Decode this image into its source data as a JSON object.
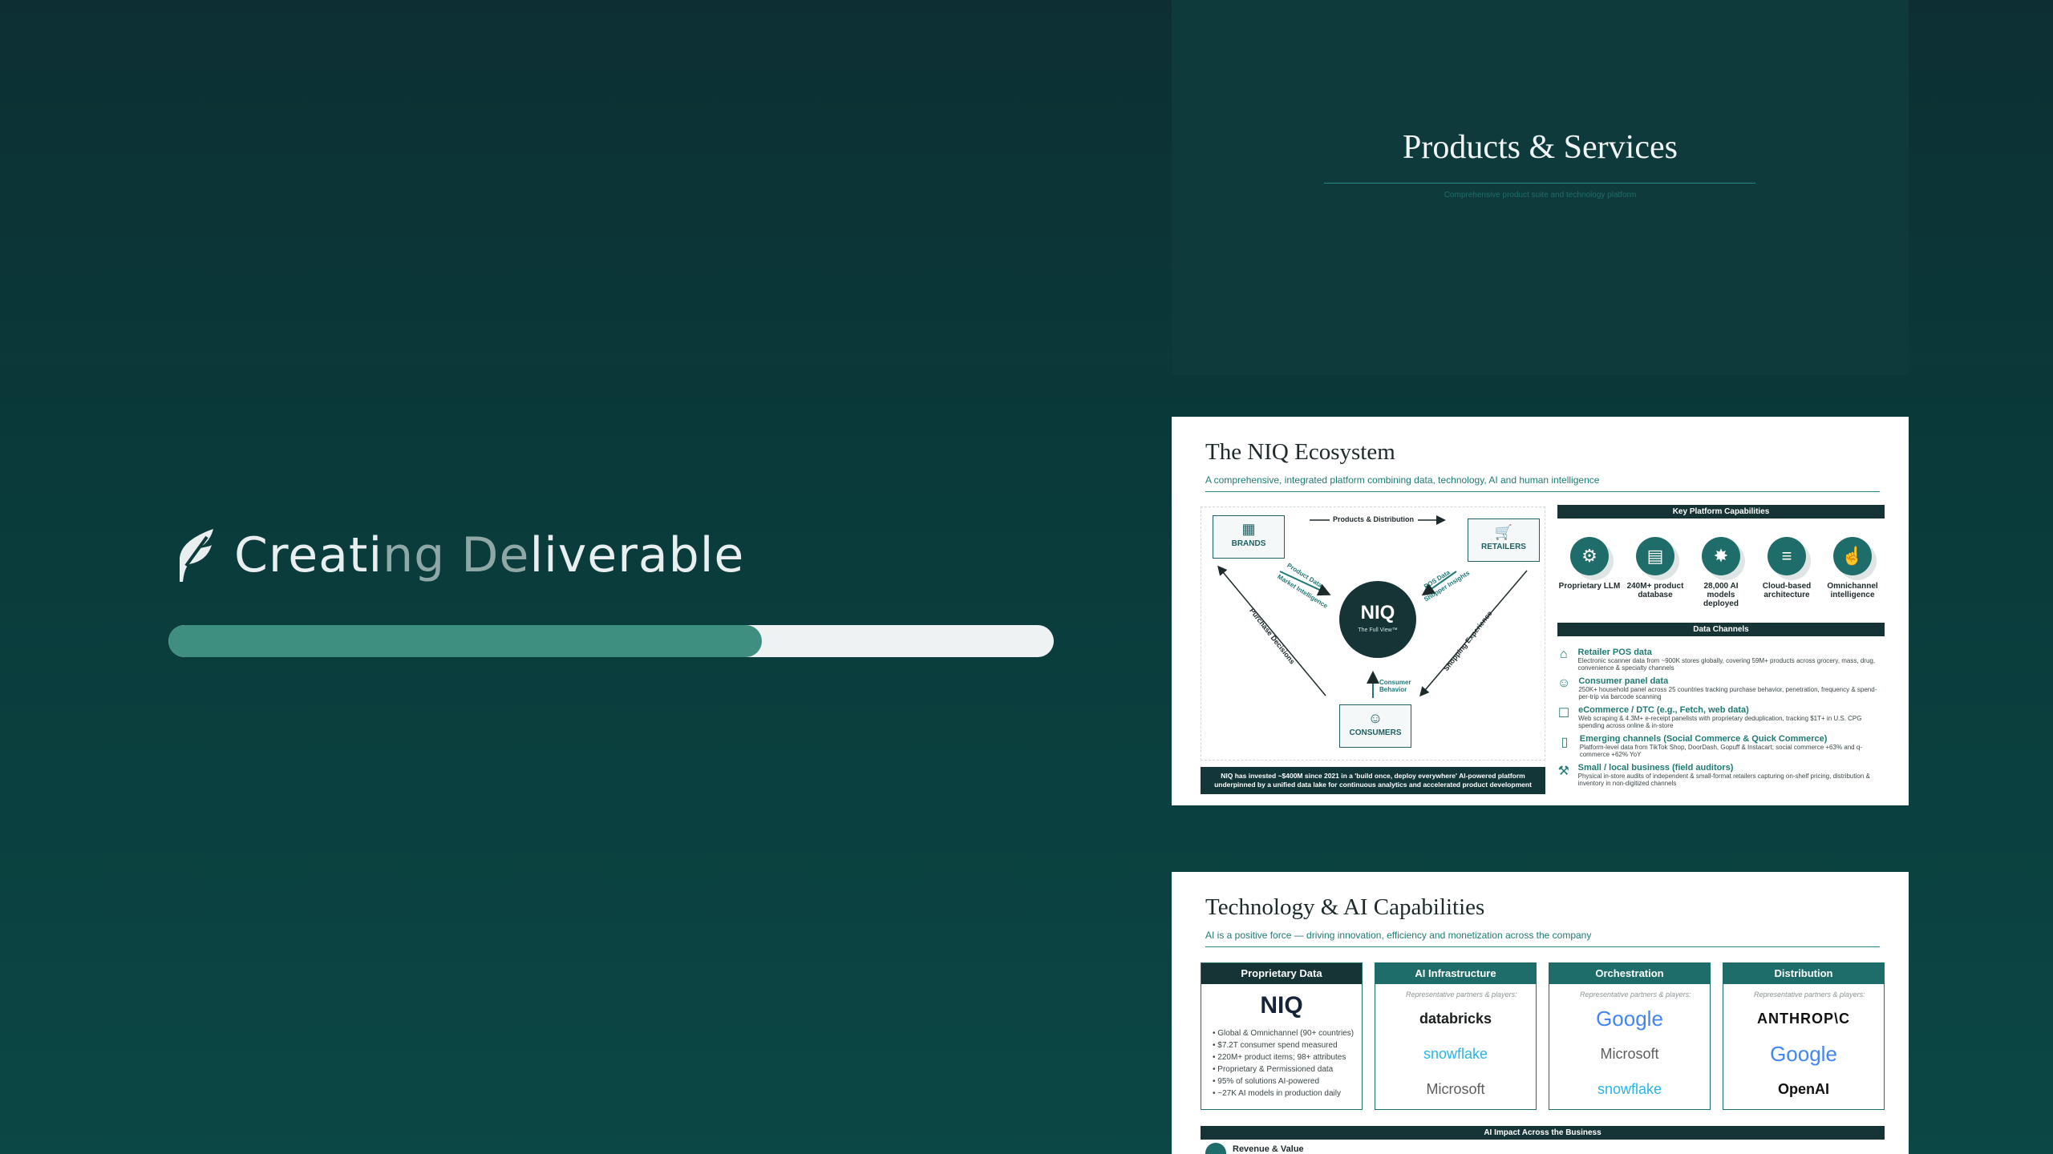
{
  "loader": {
    "title_part1": "Creati",
    "title_part2": "ng De",
    "title_part3": "liverable",
    "progress_fraction": 0.67,
    "colors": {
      "fill": "#3e8f7f",
      "track": "#eef2f2"
    }
  },
  "slide1": {
    "title": "Products & Services",
    "subtitle": "Comprehensive product suite and technology platform"
  },
  "slide2": {
    "title": "The NIQ Ecosystem",
    "subtitle": "A comprehensive, integrated platform combining data, technology, AI and human intelligence",
    "diagram": {
      "brands": "BRANDS",
      "retailers": "RETAILERS",
      "consumers": "CONSUMERS",
      "hub_title": "NIQ",
      "hub_sub": "The Full View™",
      "products_distribution": "Products & Distribution",
      "product_data": "Product Data",
      "market_intelligence": "Market Intelligence",
      "pos_data": "POS Data",
      "shopper_insights": "Shopper Insights",
      "purchase_decisions": "Purchase Decisions",
      "shopping_experience": "Shopping Experience",
      "consumer_behavior": "Consumer Behavior"
    },
    "investment_note": "NIQ has invested ~$400M since 2021 in a 'build once, deploy everywhere' AI-powered platform underpinned by a unified data lake for continuous analytics and accelerated product development",
    "capabilities_header": "Key Platform Capabilities",
    "capabilities": [
      {
        "icon": "llm-icon",
        "glyph": "⚙",
        "label": "Proprietary LLM"
      },
      {
        "icon": "database-icon",
        "glyph": "▤",
        "label": "240M+ product database"
      },
      {
        "icon": "ai-models-icon",
        "glyph": "✸",
        "label": "28,000 AI models deployed"
      },
      {
        "icon": "cloud-layers-icon",
        "glyph": "≡",
        "label": "Cloud-based architecture"
      },
      {
        "icon": "omnichannel-icon",
        "glyph": "☝",
        "label": "Omnichannel intelligence"
      }
    ],
    "channels_header": "Data Channels",
    "channels": [
      {
        "icon": "store-icon",
        "glyph": "⌂",
        "title": "Retailer POS data",
        "desc": "Electronic scanner data from ~900K stores globally, covering 59M+ products across grocery, mass, drug, convenience & specialty channels"
      },
      {
        "icon": "panel-icon",
        "glyph": "☺",
        "title": "Consumer panel data",
        "desc": "250K+ household panel across 25 countries tracking purchase behavior, penetration, frequency & spend-per-trip via barcode scanning"
      },
      {
        "icon": "ecommerce-icon",
        "glyph": "☐",
        "title": "eCommerce / DTC (e.g., Fetch, web data)",
        "desc": "Web scraping & 4.3M+ e-receipt panelists with proprietary deduplication, tracking $1T+ in U.S. CPG spending across online & in-store"
      },
      {
        "icon": "mobile-icon",
        "glyph": "▯",
        "title": "Emerging channels (Social Commerce & Quick Commerce)",
        "desc": "Platform-level data from TikTok Shop, DoorDash, Gopuff & Instacart; social commerce +63% and q-commerce +62% YoY"
      },
      {
        "icon": "field-auditor-icon",
        "glyph": "⚒",
        "title": "Small / local business (field auditors)",
        "desc": "Physical in-store audits of independent & small-format retailers capturing on-shelf pricing, distribution & inventory in non-digitized channels"
      }
    ]
  },
  "slide3": {
    "title": "Technology & AI Capabilities",
    "subtitle": "AI is a positive force — driving innovation, efficiency and monetization across the company",
    "rep_label": "Representative partners & players:",
    "columns": [
      {
        "header": "Proprietary Data",
        "logo": "NIQ",
        "bullets": [
          "• Global & Omnichannel (90+ countries)",
          "• $7.2T consumer spend measured",
          "• 220M+ product items; 98+ attributes",
          "• Proprietary & Permissioned data",
          "• 95% of solutions AI-powered",
          "• ~27K AI models in production daily"
        ]
      },
      {
        "header": "AI Infrastructure",
        "partners": [
          "databricks",
          "snowflake",
          "Microsoft"
        ]
      },
      {
        "header": "Orchestration",
        "partners": [
          "Google",
          "Microsoft",
          "snowflake"
        ]
      },
      {
        "header": "Distribution",
        "partners": [
          "ANTHROP\\C",
          "Google",
          "OpenAI"
        ]
      }
    ],
    "impact_header": "AI Impact Across the Business",
    "impact_item": "Revenue & Value"
  }
}
